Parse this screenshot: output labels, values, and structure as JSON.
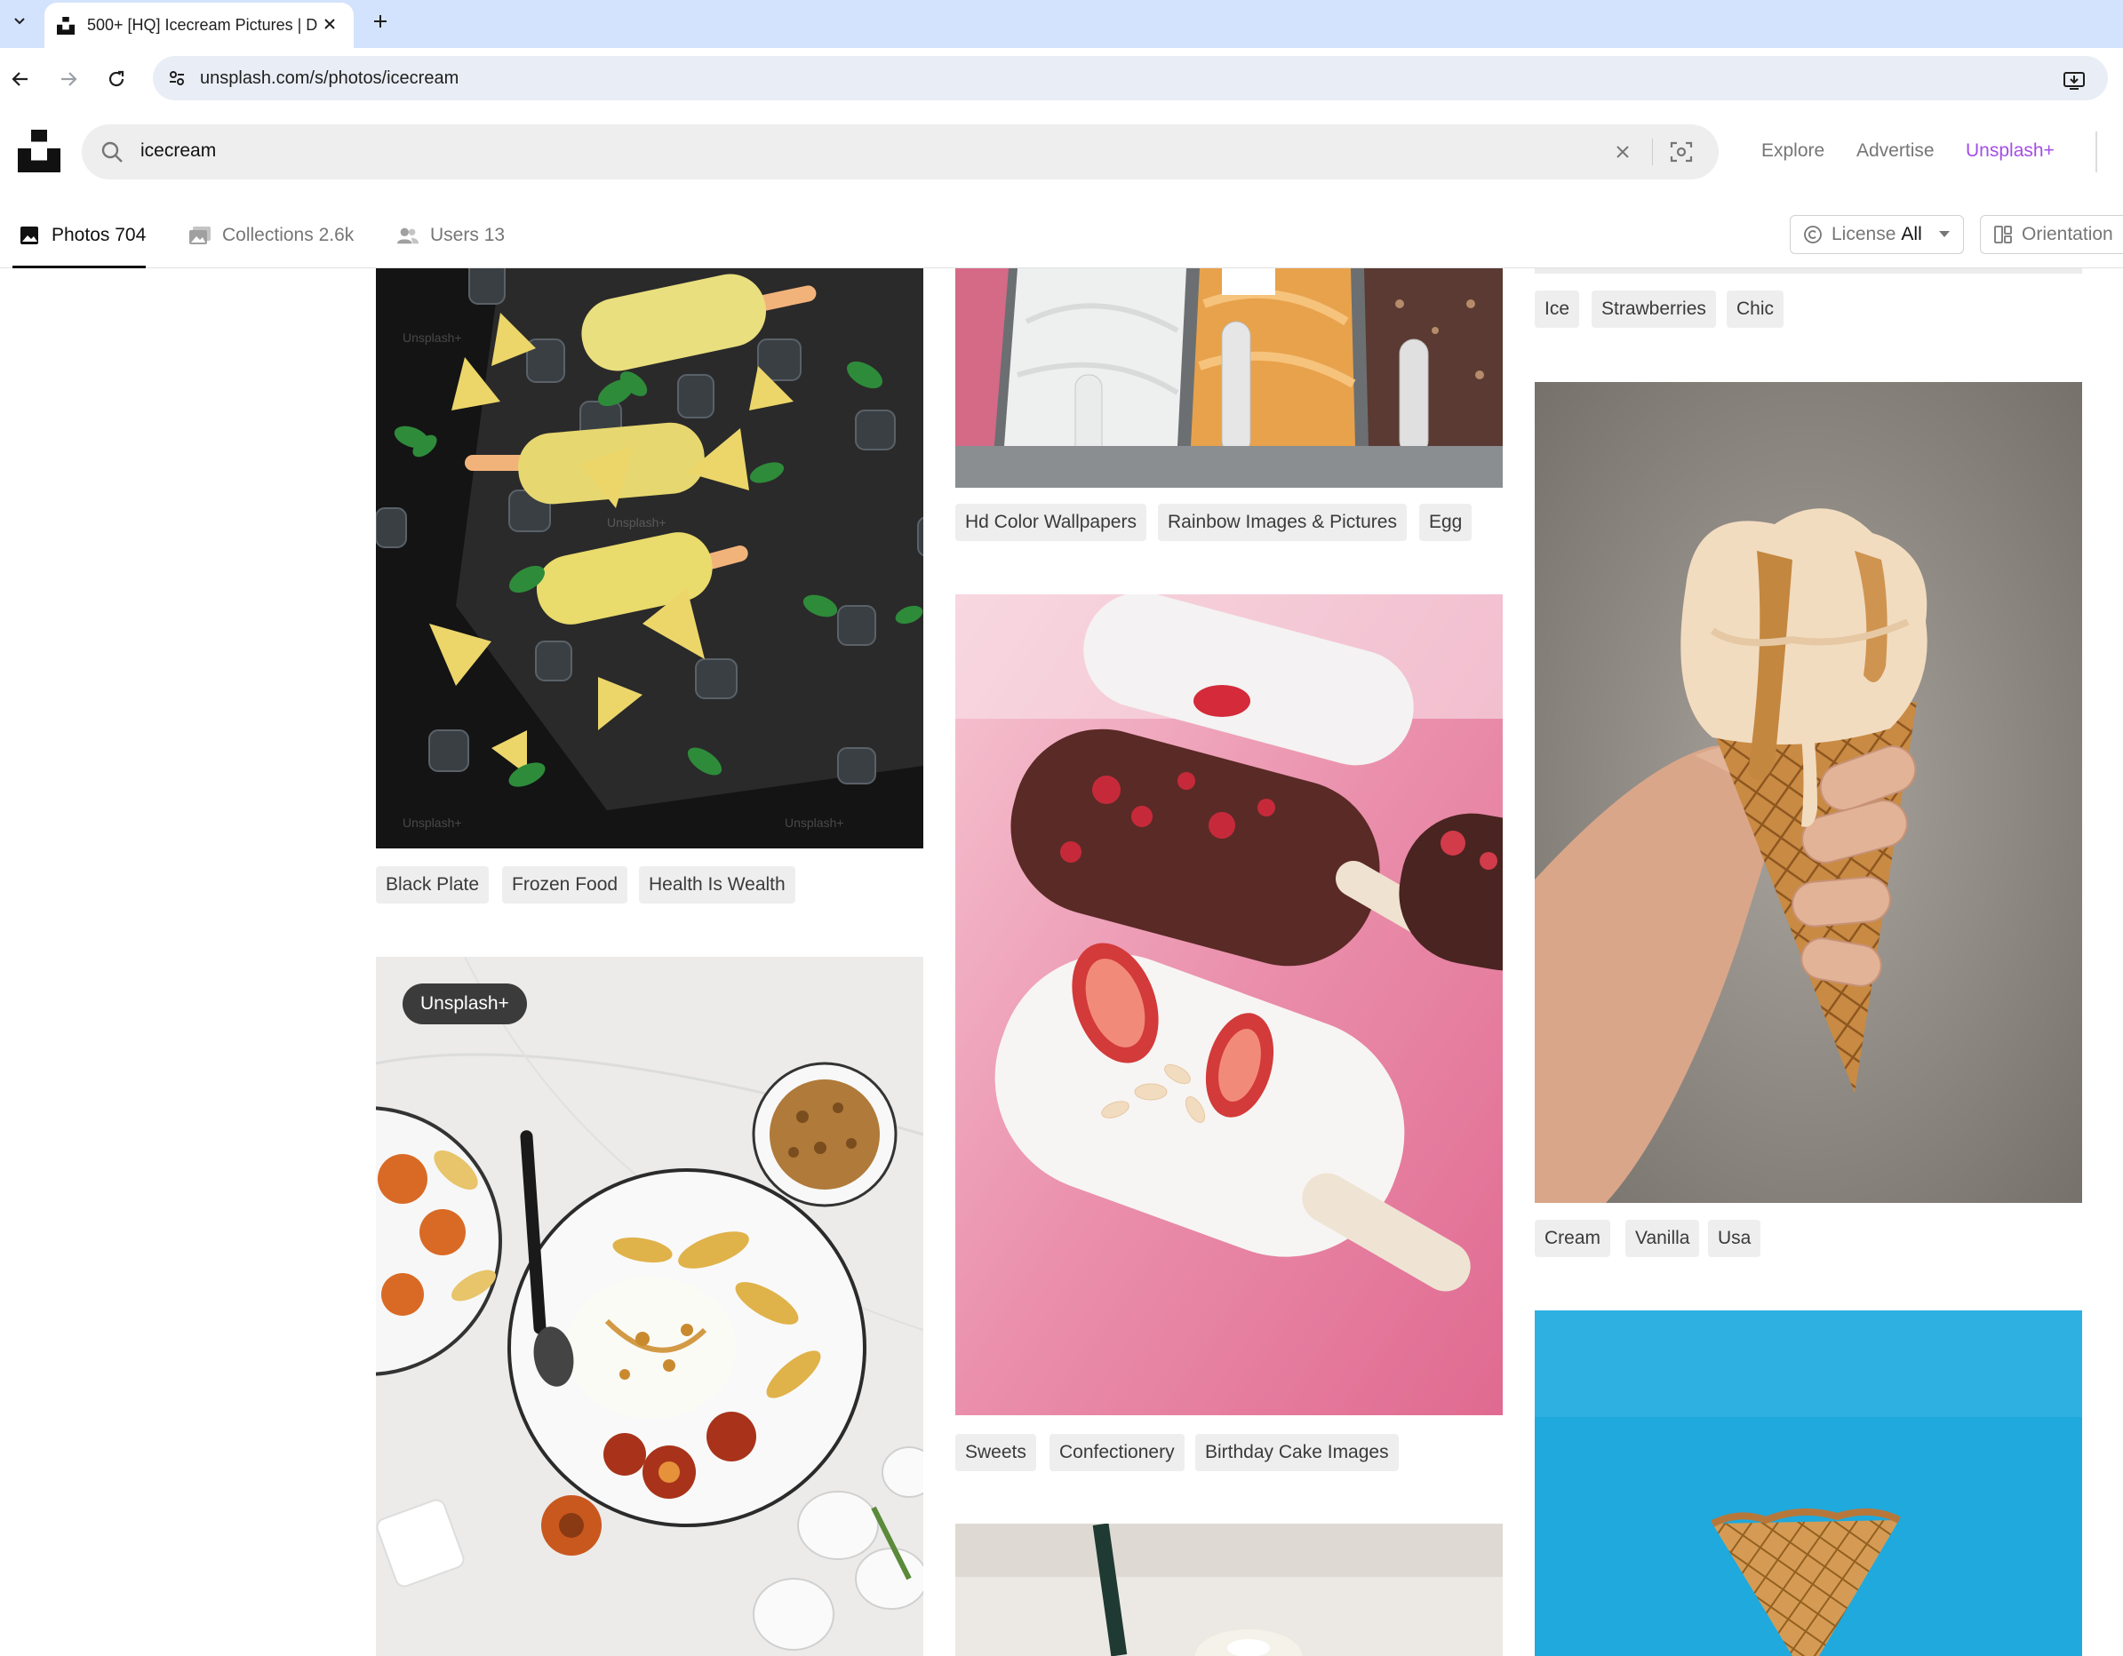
{
  "browser": {
    "tab_title": "500+ [HQ] Icecream Pictures | D",
    "url": "unsplash.com/s/photos/icecream"
  },
  "header": {
    "search_value": "icecream",
    "nav": [
      "Explore",
      "Advertise",
      "Unsplash+"
    ]
  },
  "filters": {
    "tabs": [
      {
        "label": "Photos",
        "count": "704"
      },
      {
        "label": "Collections",
        "count": "2.6k"
      },
      {
        "label": "Users",
        "count": "13"
      }
    ],
    "license_label": "License",
    "license_value": "All",
    "orientation_label": "Orientation"
  },
  "columns": [
    {
      "cards": [
        {
          "alt": "Melon popsicles with ice cubes and mint on dark slate",
          "tags": [
            "Black Plate",
            "Frozen Food",
            "Health Is Wealth"
          ],
          "watermark": "Unsplash+"
        },
        {
          "alt": "Yogurt bowl with grilled peaches and granola on marble",
          "badge": "Unsplash+",
          "tags": []
        }
      ]
    },
    {
      "cards": [
        {
          "alt": "Gelato display trays",
          "tags": [
            "Hd Color Wallpapers",
            "Rainbow Images & Pictures",
            "Egg"
          ]
        },
        {
          "alt": "White chocolate ice cream bars with strawberries on pink",
          "tags": [
            "Sweets",
            "Confectionery",
            "Birthday Cake Images"
          ]
        },
        {
          "alt": "Ice cream cup with straw",
          "tags": []
        }
      ]
    },
    {
      "cards": [
        {
          "alt": "Previous photo",
          "tags": [
            "Ice",
            "Strawberries",
            "Chic"
          ]
        },
        {
          "alt": "Hand holding vanilla ice cream waffle cone",
          "tags": [
            "Cream",
            "Vanilla",
            "Usa"
          ]
        },
        {
          "alt": "Waffle cone on blue background",
          "tags": []
        }
      ]
    }
  ],
  "colors": {
    "accent_plus": "#a44ee4",
    "tag_bg": "#eeeeee",
    "chrome_tabstrip": "#d3e3fd"
  }
}
